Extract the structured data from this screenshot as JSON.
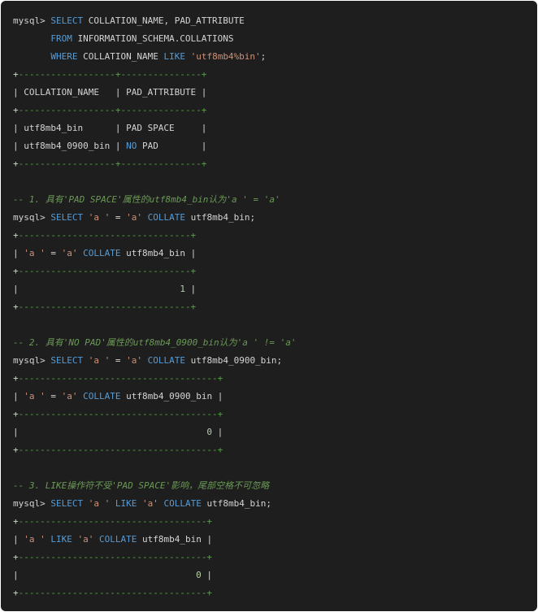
{
  "colors": {
    "background": "#1e1e1e",
    "text": "#d4d4d4",
    "keyword": "#569cd6",
    "string": "#ce9178",
    "comment": "#6a9955",
    "number": "#b5cea8",
    "border": "#4fa83d"
  },
  "lines": [
    [
      [
        "p",
        "mysql> "
      ],
      [
        "kw",
        "SELECT"
      ],
      [
        "p",
        " COLLATION_NAME, PAD_ATTRIBUTE"
      ]
    ],
    [
      [
        "p",
        "       "
      ],
      [
        "kw",
        "FROM"
      ],
      [
        "p",
        " INFORMATION_SCHEMA.COLLATIONS"
      ]
    ],
    [
      [
        "p",
        "       "
      ],
      [
        "kw",
        "WHERE"
      ],
      [
        "p",
        " COLLATION_NAME "
      ],
      [
        "kw",
        "LIKE"
      ],
      [
        "p",
        " "
      ],
      [
        "str",
        "'utf8mb4%bin'"
      ],
      [
        "p",
        ";"
      ]
    ],
    [
      [
        "plus",
        "+"
      ],
      [
        "bd",
        "------------------+---------------+"
      ]
    ],
    [
      [
        "p",
        "| COLLATION_NAME   | PAD_ATTRIBUTE |"
      ]
    ],
    [
      [
        "plus",
        "+"
      ],
      [
        "bd",
        "------------------+---------------+"
      ]
    ],
    [
      [
        "p",
        "| utf8mb4_bin      | PAD SPACE     |"
      ]
    ],
    [
      [
        "p",
        "| utf8mb4_0900_bin | "
      ],
      [
        "kw",
        "NO"
      ],
      [
        "p",
        " PAD        |"
      ]
    ],
    [
      [
        "plus",
        "+"
      ],
      [
        "bd",
        "------------------+---------------+"
      ]
    ],
    [],
    [
      [
        "cm",
        "-- 1. 具有'PAD SPACE'属性的utf8mb4_bin认为'a ' = 'a'"
      ]
    ],
    [
      [
        "p",
        "mysql> "
      ],
      [
        "kw",
        "SELECT"
      ],
      [
        "p",
        " "
      ],
      [
        "str",
        "'a '"
      ],
      [
        "p",
        " = "
      ],
      [
        "str",
        "'a'"
      ],
      [
        "p",
        " "
      ],
      [
        "kw",
        "COLLATE"
      ],
      [
        "p",
        " utf8mb4_bin;"
      ]
    ],
    [
      [
        "plus",
        "+"
      ],
      [
        "bd",
        "--------------------------------+"
      ]
    ],
    [
      [
        "p",
        "| "
      ],
      [
        "str",
        "'a '"
      ],
      [
        "p",
        " = "
      ],
      [
        "str",
        "'a'"
      ],
      [
        "p",
        " "
      ],
      [
        "kw",
        "COLLATE"
      ],
      [
        "p",
        " utf8mb4_bin |"
      ]
    ],
    [
      [
        "plus",
        "+"
      ],
      [
        "bd",
        "--------------------------------+"
      ]
    ],
    [
      [
        "p",
        "|                              "
      ],
      [
        "num",
        "1"
      ],
      [
        "p",
        " |"
      ]
    ],
    [
      [
        "plus",
        "+"
      ],
      [
        "bd",
        "--------------------------------+"
      ]
    ],
    [],
    [
      [
        "cm",
        "-- 2. 具有'NO PAD'属性的utf8mb4_0900_bin认为'a ' != 'a'"
      ]
    ],
    [
      [
        "p",
        "mysql> "
      ],
      [
        "kw",
        "SELECT"
      ],
      [
        "p",
        " "
      ],
      [
        "str",
        "'a '"
      ],
      [
        "p",
        " = "
      ],
      [
        "str",
        "'a'"
      ],
      [
        "p",
        " "
      ],
      [
        "kw",
        "COLLATE"
      ],
      [
        "p",
        " utf8mb4_0900_bin;"
      ]
    ],
    [
      [
        "plus",
        "+"
      ],
      [
        "bd",
        "-------------------------------------+"
      ]
    ],
    [
      [
        "p",
        "| "
      ],
      [
        "str",
        "'a '"
      ],
      [
        "p",
        " = "
      ],
      [
        "str",
        "'a'"
      ],
      [
        "p",
        " "
      ],
      [
        "kw",
        "COLLATE"
      ],
      [
        "p",
        " utf8mb4_0900_bin |"
      ]
    ],
    [
      [
        "plus",
        "+"
      ],
      [
        "bd",
        "-------------------------------------+"
      ]
    ],
    [
      [
        "p",
        "|                                   "
      ],
      [
        "num",
        "0"
      ],
      [
        "p",
        " |"
      ]
    ],
    [
      [
        "plus",
        "+"
      ],
      [
        "bd",
        "-------------------------------------+"
      ]
    ],
    [],
    [
      [
        "cm",
        "-- 3. LIKE操作符不受'PAD SPACE'影响，尾部空格不可忽略"
      ]
    ],
    [
      [
        "p",
        "mysql> "
      ],
      [
        "kw",
        "SELECT"
      ],
      [
        "p",
        " "
      ],
      [
        "str",
        "'a '"
      ],
      [
        "p",
        " "
      ],
      [
        "kw",
        "LIKE"
      ],
      [
        "p",
        " "
      ],
      [
        "str",
        "'a'"
      ],
      [
        "p",
        " "
      ],
      [
        "kw",
        "COLLATE"
      ],
      [
        "p",
        " utf8mb4_bin;"
      ]
    ],
    [
      [
        "plus",
        "+"
      ],
      [
        "bd",
        "-----------------------------------+"
      ]
    ],
    [
      [
        "p",
        "| "
      ],
      [
        "str",
        "'a '"
      ],
      [
        "p",
        " "
      ],
      [
        "kw",
        "LIKE"
      ],
      [
        "p",
        " "
      ],
      [
        "str",
        "'a'"
      ],
      [
        "p",
        " "
      ],
      [
        "kw",
        "COLLATE"
      ],
      [
        "p",
        " utf8mb4_bin |"
      ]
    ],
    [
      [
        "plus",
        "+"
      ],
      [
        "bd",
        "-----------------------------------+"
      ]
    ],
    [
      [
        "p",
        "|                                 "
      ],
      [
        "num",
        "0"
      ],
      [
        "p",
        " |"
      ]
    ],
    [
      [
        "plus",
        "+"
      ],
      [
        "bd",
        "-----------------------------------+"
      ]
    ]
  ]
}
